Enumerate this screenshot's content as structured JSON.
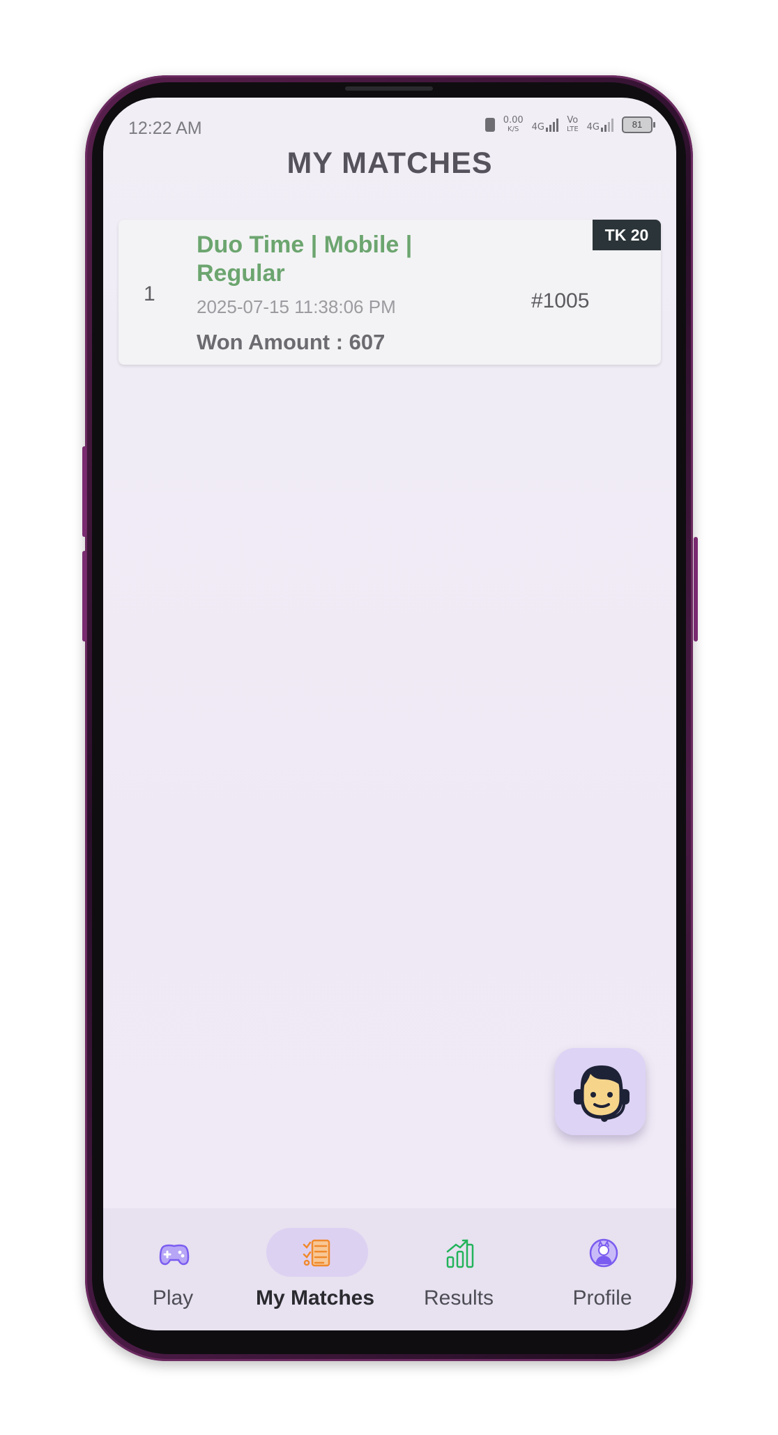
{
  "status_bar": {
    "time": "12:22 AM",
    "net_speed": "0.00",
    "net_unit": "K/S",
    "sim1": "4G",
    "volte_top": "Vo",
    "volte_bottom": "LTE",
    "sim2": "4G",
    "battery": "81"
  },
  "header": {
    "title": "MY MATCHES"
  },
  "matches": [
    {
      "index": "1",
      "title": "Duo Time | Mobile | Regular",
      "datetime": "2025-07-15 11:38:06 PM",
      "won_amount": "Won Amount : 607",
      "match_id": "#1005",
      "fee": "TK 20"
    }
  ],
  "support_button": {
    "icon": "customer-support-agent-icon"
  },
  "bottom_nav": {
    "active": "My Matches",
    "items": [
      {
        "label": "Play",
        "icon": "gamepad-icon",
        "color": "#7b5cf0"
      },
      {
        "label": "My Matches",
        "icon": "list-icon",
        "color": "#f08a2c"
      },
      {
        "label": "Results",
        "icon": "chart-up-icon",
        "color": "#22b35a"
      },
      {
        "label": "Profile",
        "icon": "avatar-icon",
        "color": "#7b5cf0"
      }
    ]
  }
}
